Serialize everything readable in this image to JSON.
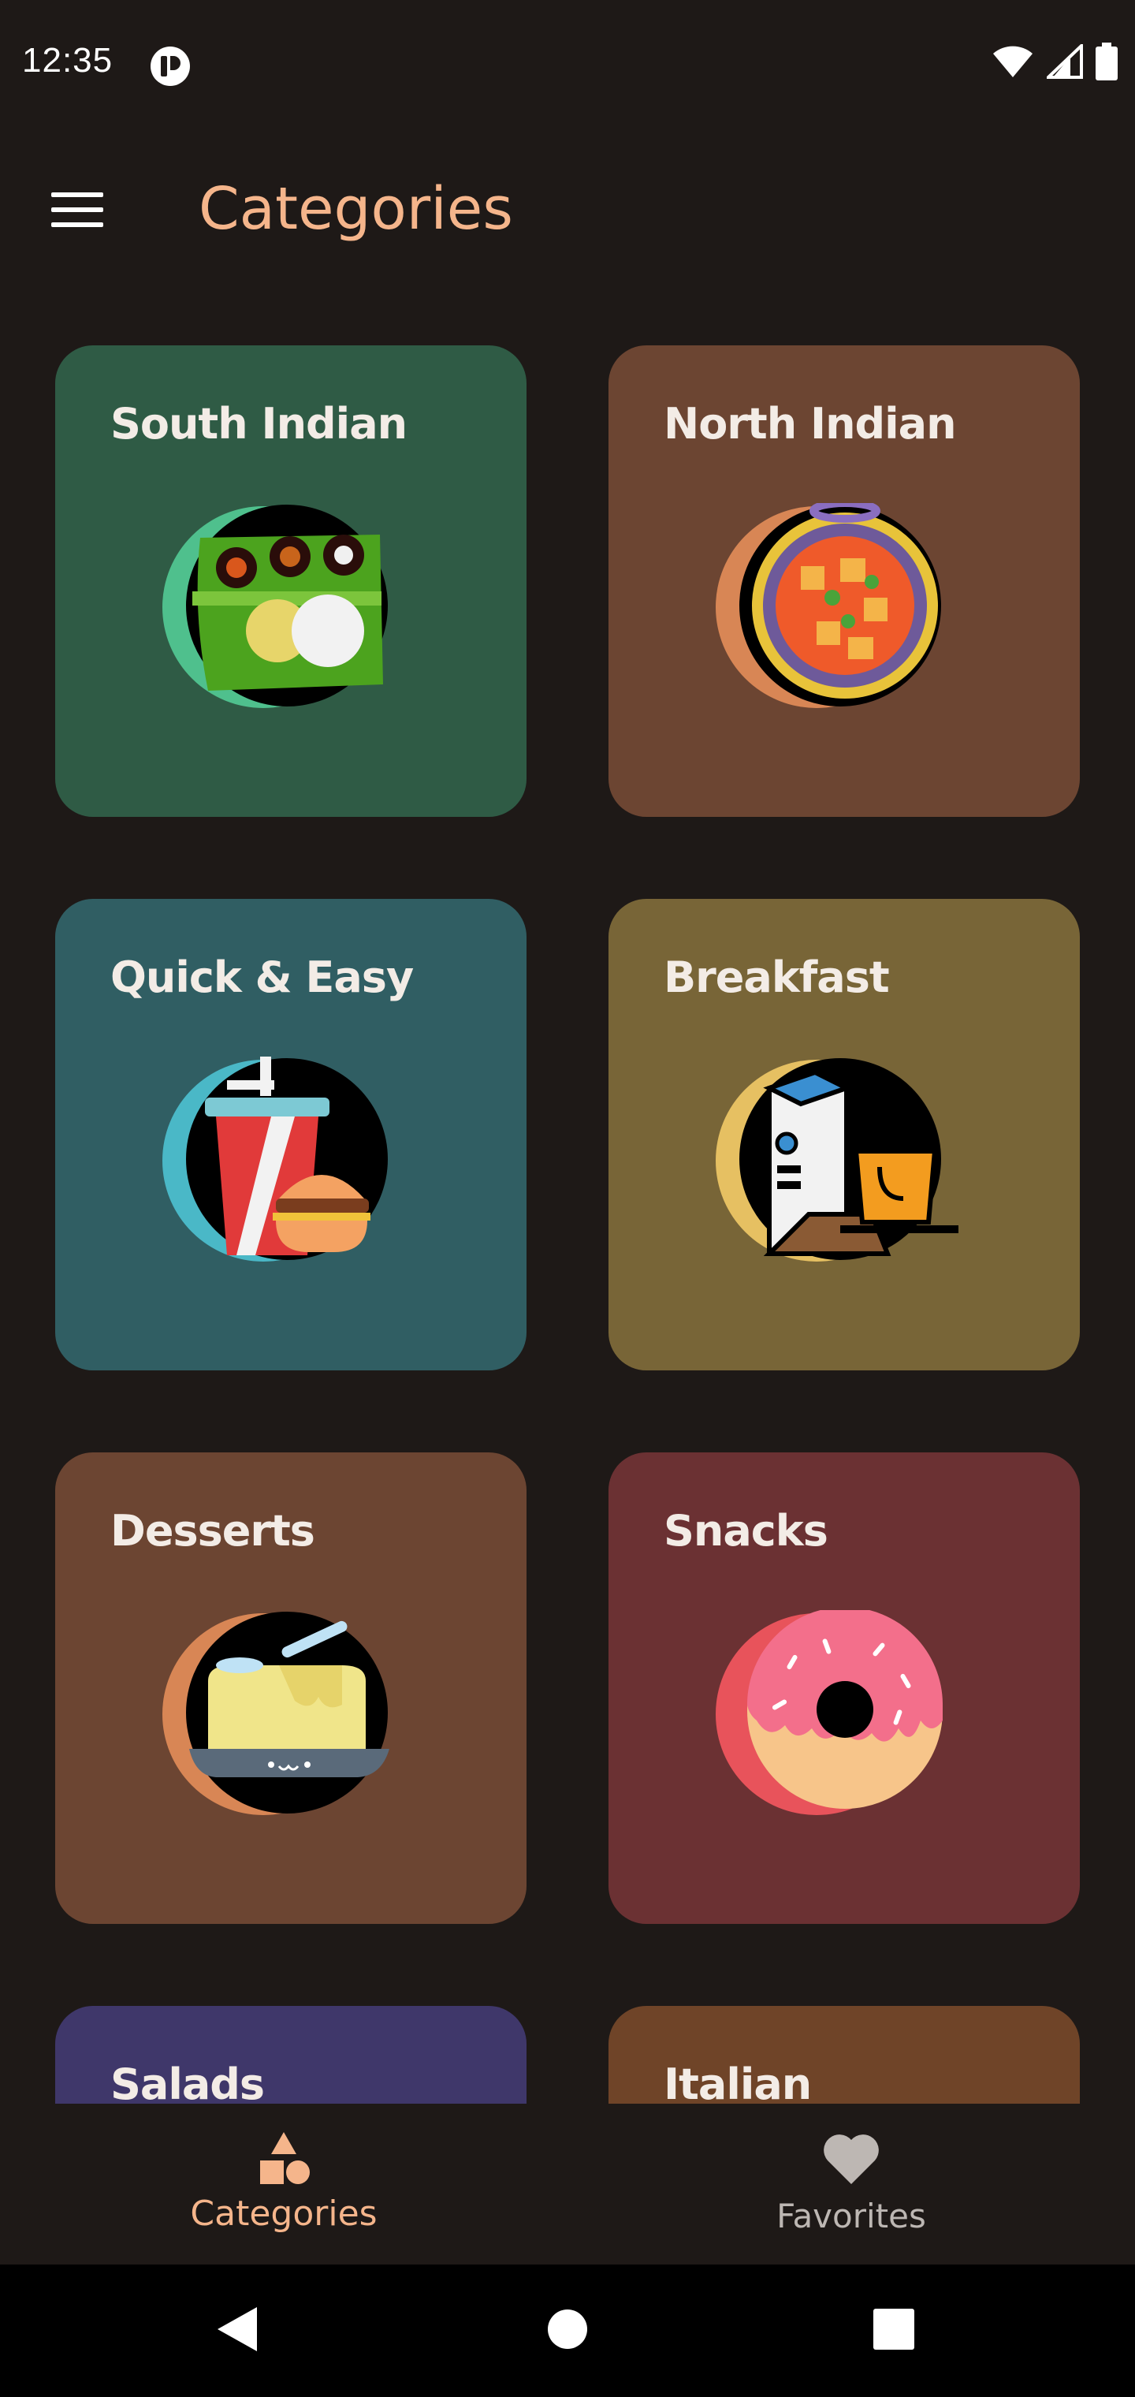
{
  "status_bar": {
    "time": "12:35",
    "icons": [
      "app-notification-icon",
      "wifi-icon",
      "cellular-icon",
      "battery-icon"
    ]
  },
  "app_bar": {
    "title": "Categories",
    "menu_icon": "hamburger-menu-icon"
  },
  "categories": [
    {
      "label": "South Indian",
      "color": "#2f5b45",
      "icon": "banana-leaf-meal-icon"
    },
    {
      "label": "North Indian",
      "color": "#6c4532",
      "icon": "curry-bowl-icon"
    },
    {
      "label": "Quick & Easy",
      "color": "#305e63",
      "icon": "soda-burger-icon"
    },
    {
      "label": "Breakfast",
      "color": "#786537",
      "icon": "milk-coffee-icon"
    },
    {
      "label": "Desserts",
      "color": "#6c4532",
      "icon": "pudding-icon"
    },
    {
      "label": "Snacks",
      "color": "#6b3133",
      "icon": "donut-icon"
    },
    {
      "label": "Salads",
      "color": "#3f376a",
      "icon": "salad-icon"
    },
    {
      "label": "Italian",
      "color": "#6f4428",
      "icon": "pizza-icon"
    }
  ],
  "bottom_nav": {
    "items": [
      {
        "label": "Categories",
        "icon": "shapes-icon",
        "active": true
      },
      {
        "label": "Favorites",
        "icon": "heart-icon",
        "active": false
      }
    ]
  },
  "colors": {
    "accent": "#f5b58b",
    "background": "#1e1917",
    "inactive": "#bdb7b3"
  }
}
